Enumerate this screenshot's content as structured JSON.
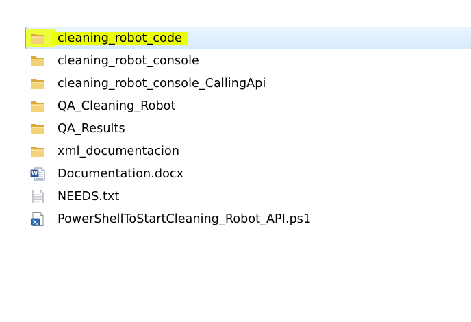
{
  "files": [
    {
      "name": "cleaning_robot_code",
      "icon": "folder-icon",
      "selected": true
    },
    {
      "name": "cleaning_robot_console",
      "icon": "folder-icon"
    },
    {
      "name": "cleaning_robot_console_CallingApi",
      "icon": "folder-icon"
    },
    {
      "name": "QA_Cleaning_Robot",
      "icon": "folder-icon"
    },
    {
      "name": "QA_Results",
      "icon": "folder-icon"
    },
    {
      "name": "xml_documentacion",
      "icon": "folder-icon"
    },
    {
      "name": "Documentation.docx",
      "icon": "word-document-icon"
    },
    {
      "name": "NEEDS.txt",
      "icon": "text-file-icon"
    },
    {
      "name": "PowerShellToStartCleaning_Robot_API.ps1",
      "icon": "powershell-script-icon"
    }
  ],
  "colors": {
    "selection_border": "#7da2ce",
    "selection_fill": "#d8ebfc",
    "highlight": "#eaff00",
    "folder": "#e8c15a"
  }
}
